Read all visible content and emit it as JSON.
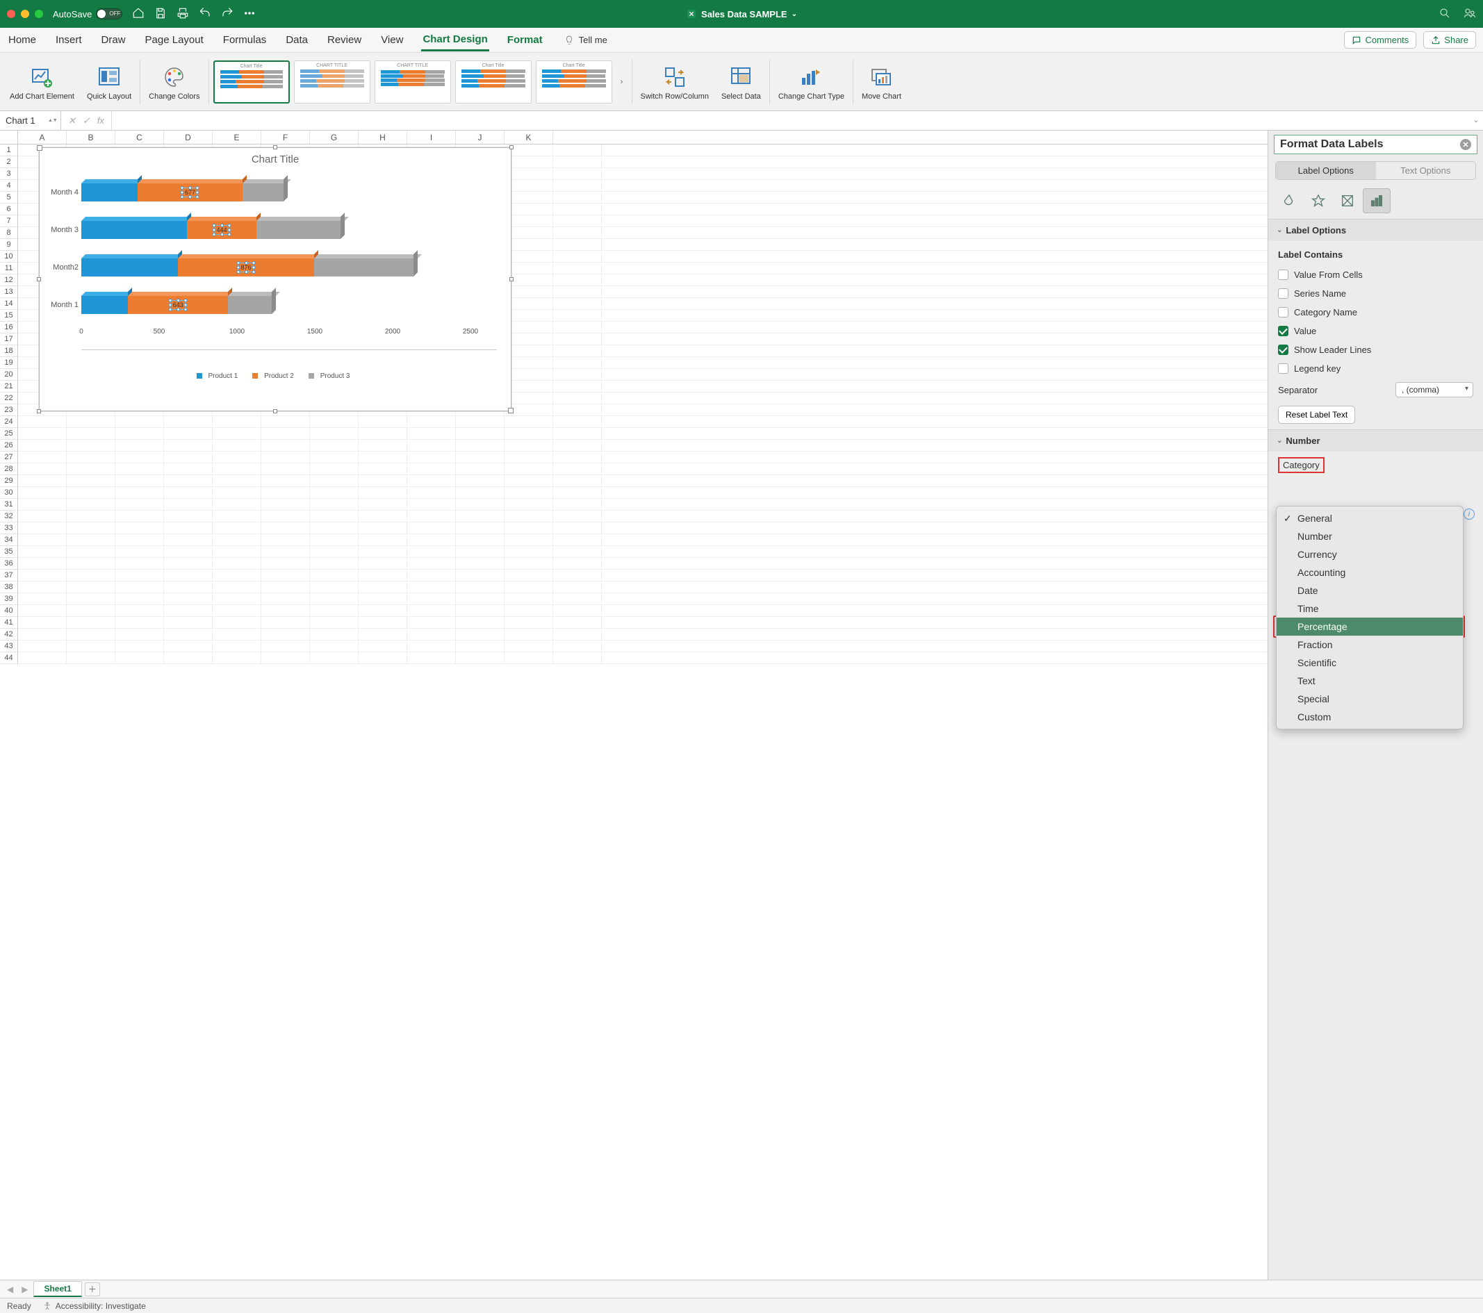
{
  "titlebar": {
    "autosave_label": "AutoSave",
    "autosave_state": "OFF",
    "doc_name": "Sales Data SAMPLE"
  },
  "tabs": [
    "Home",
    "Insert",
    "Draw",
    "Page Layout",
    "Formulas",
    "Data",
    "Review",
    "View",
    "Chart Design",
    "Format"
  ],
  "tellme": "Tell me",
  "share": {
    "comments": "Comments",
    "share": "Share"
  },
  "ribbon": {
    "add_chart": "Add Chart Element",
    "quick_layout": "Quick Layout",
    "change_colors": "Change Colors",
    "switch": "Switch Row/Column",
    "select_data": "Select Data",
    "change_type": "Change Chart Type",
    "move_chart": "Move Chart",
    "style_titles": [
      "Chart Title",
      "CHART TITLE",
      "CHART TITLE",
      "Chart Title",
      "Chart Title"
    ]
  },
  "namebox": "Chart 1",
  "columns": [
    "A",
    "B",
    "C",
    "D",
    "E",
    "F",
    "G",
    "H",
    "I",
    "J",
    "K"
  ],
  "chart_data": {
    "type": "bar",
    "stacked": true,
    "title": "Chart Title",
    "categories": [
      "Month 1",
      "Month2",
      "Month 3",
      "Month 4"
    ],
    "series": [
      {
        "name": "Product 1",
        "color": "#2196d6",
        "values": [
          300,
          620,
          680,
          360
        ]
      },
      {
        "name": "Product 2",
        "color": "#ec7c30",
        "values": [
          643,
          876,
          444,
          677
        ]
      },
      {
        "name": "Product 3",
        "color": "#a5a5a5",
        "values": [
          280,
          640,
          540,
          260
        ]
      }
    ],
    "data_labels_series_index": 1,
    "data_labels": [
      643,
      876,
      444,
      677
    ],
    "xlim": [
      0,
      2500
    ],
    "xticks": [
      0,
      500,
      1000,
      1500,
      2000,
      2500
    ],
    "legend": [
      "Product 1",
      "Product 2",
      "Product 3"
    ]
  },
  "panel": {
    "title": "Format Data Labels",
    "tab_label": "Label Options",
    "tab_text": "Text Options",
    "section_label": "Label Options",
    "contains_heading": "Label Contains",
    "opts": {
      "value_from_cells": "Value From Cells",
      "series_name": "Series Name",
      "category_name": "Category Name",
      "value": "Value",
      "leader": "Show Leader Lines",
      "legend_key": "Legend key"
    },
    "separator_label": "Separator",
    "separator_value": ", (comma)",
    "reset": "Reset Label Text",
    "number_section": "Number",
    "category_label": "Category",
    "category_items": [
      "General",
      "Number",
      "Currency",
      "Accounting",
      "Date",
      "Time",
      "Percentage",
      "Fraction",
      "Scientific",
      "Text",
      "Special",
      "Custom"
    ],
    "category_checked": "General",
    "category_highlight": "Percentage"
  },
  "sheet": "Sheet1",
  "status": {
    "ready": "Ready",
    "acc": "Accessibility: Investigate"
  }
}
